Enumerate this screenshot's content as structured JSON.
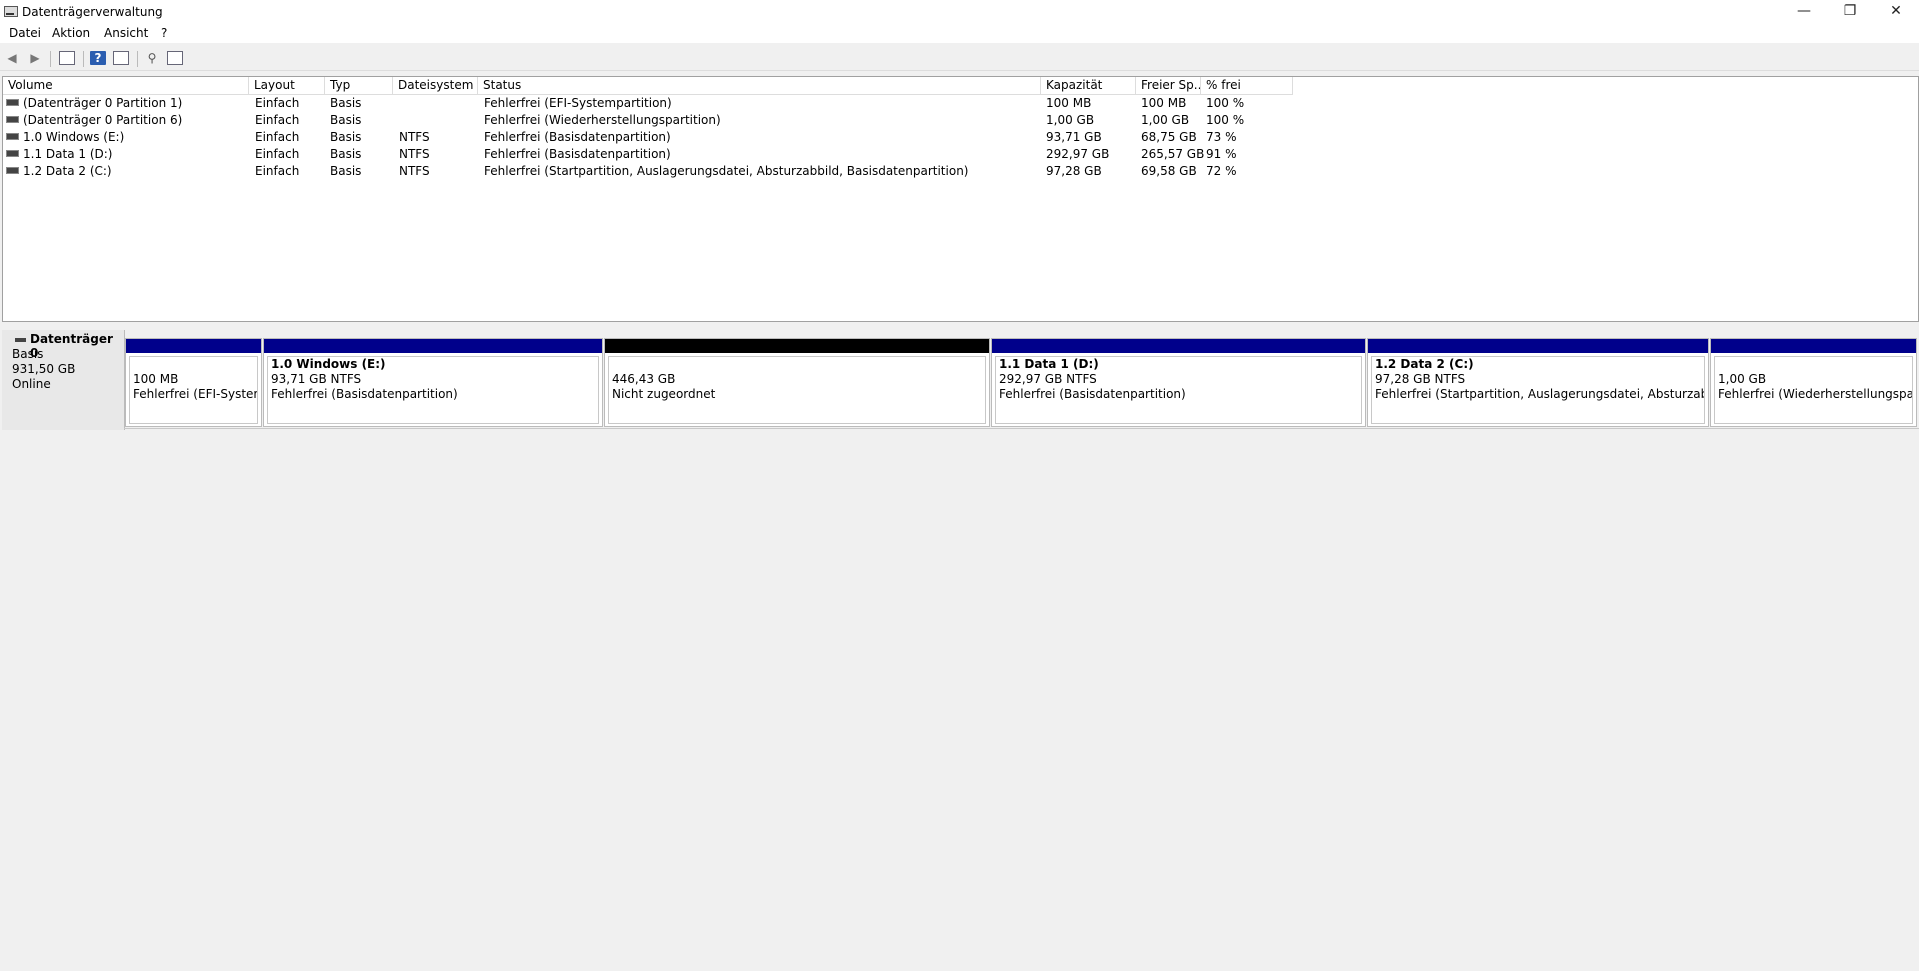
{
  "window": {
    "title": "Datenträgerverwaltung",
    "controls": {
      "minimize": "—",
      "restore": "❐",
      "close": "✕"
    }
  },
  "menu": [
    "Datei",
    "Aktion",
    "Ansicht",
    "?"
  ],
  "toolbar": {
    "icons": [
      "back-arrow-icon",
      "forward-arrow-icon",
      "console-tree-icon",
      "help-icon",
      "properties-icon",
      "disk-action-icon",
      "list-view-icon"
    ]
  },
  "volumes": {
    "columns": [
      "Volume",
      "Layout",
      "Typ",
      "Dateisystem",
      "Status",
      "Kapazität",
      "Freier Sp...",
      "% frei"
    ],
    "rows": [
      {
        "volume": "(Datenträger 0 Partition 1)",
        "layout": "Einfach",
        "typ": "Basis",
        "fs": "",
        "status": "Fehlerfrei (EFI-Systempartition)",
        "cap": "100 MB",
        "free": "100 MB",
        "pct": "100 %"
      },
      {
        "volume": "(Datenträger 0 Partition 6)",
        "layout": "Einfach",
        "typ": "Basis",
        "fs": "",
        "status": "Fehlerfrei (Wiederherstellungspartition)",
        "cap": "1,00 GB",
        "free": "1,00 GB",
        "pct": "100 %"
      },
      {
        "volume": "1.0 Windows (E:)",
        "layout": "Einfach",
        "typ": "Basis",
        "fs": "NTFS",
        "status": "Fehlerfrei (Basisdatenpartition)",
        "cap": "93,71 GB",
        "free": "68,75 GB",
        "pct": "73 %"
      },
      {
        "volume": "1.1 Data 1 (D:)",
        "layout": "Einfach",
        "typ": "Basis",
        "fs": "NTFS",
        "status": "Fehlerfrei (Basisdatenpartition)",
        "cap": "292,97 GB",
        "free": "265,57 GB",
        "pct": "91 %"
      },
      {
        "volume": "1.2 Data 2 (C:)",
        "layout": "Einfach",
        "typ": "Basis",
        "fs": "NTFS",
        "status": "Fehlerfrei (Startpartition, Auslagerungsdatei, Absturzabbild, Basisdatenpartition)",
        "cap": "97,28 GB",
        "free": "69,58 GB",
        "pct": "72 %"
      }
    ]
  },
  "disk0": {
    "name": "Datenträger 0",
    "type": "Basis",
    "size": "931,50 GB",
    "state": "Online",
    "partitions": [
      {
        "title": "",
        "size": "100 MB",
        "status": "Fehlerfrei (EFI-Systempartition)",
        "bar": "#00008b"
      },
      {
        "title": "1.0 Windows  (E:)",
        "size": "93,71 GB NTFS",
        "status": "Fehlerfrei (Basisdatenpartition)",
        "bar": "#00008b"
      },
      {
        "title": "",
        "size": "446,43 GB",
        "status": "Nicht zugeordnet",
        "bar": "#000000"
      },
      {
        "title": "1.1 Data 1  (D:)",
        "size": "292,97 GB NTFS",
        "status": "Fehlerfrei (Basisdatenpartition)",
        "bar": "#00008b"
      },
      {
        "title": "1.2 Data 2  (C:)",
        "size": "97,28 GB NTFS",
        "status": "Fehlerfrei (Startpartition, Auslagerungsdatei, Absturzabbild, Basisdatenpartition)",
        "bar": "#00008b"
      },
      {
        "title": "",
        "size": "1,00 GB",
        "status": "Fehlerfrei (Wiederherstellungspartition)",
        "bar": "#00008b"
      }
    ]
  }
}
